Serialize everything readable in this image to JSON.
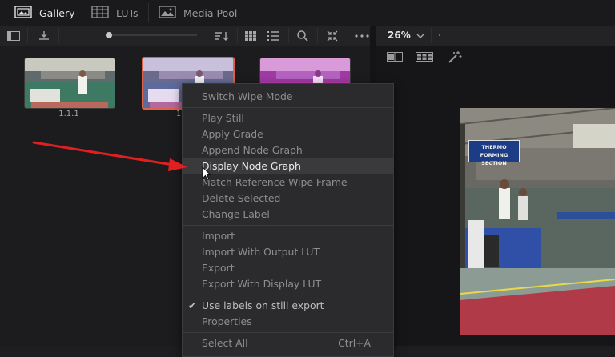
{
  "top_tabs": [
    {
      "label": "Gallery",
      "icon": "gallery-icon"
    },
    {
      "label": "LUTs",
      "icon": "luts-icon"
    },
    {
      "label": "Media Pool",
      "icon": "media-pool-icon"
    }
  ],
  "viewer": {
    "zoom": "26%"
  },
  "thumbnails": [
    {
      "label": "1.1.1"
    },
    {
      "label": "1"
    },
    {
      "label": ""
    }
  ],
  "context_menu": {
    "items": [
      {
        "label": "Switch Wipe Mode",
        "enabled": false
      },
      {
        "label": "Play Still",
        "enabled": false
      },
      {
        "label": "Apply Grade",
        "enabled": false
      },
      {
        "label": "Append Node Graph",
        "enabled": false
      },
      {
        "label": "Display Node Graph",
        "enabled": true,
        "hover": true
      },
      {
        "label": "Match Reference Wipe Frame",
        "enabled": false
      },
      {
        "label": "Delete Selected",
        "enabled": false
      },
      {
        "label": "Change Label",
        "enabled": false
      },
      {
        "label": "Import",
        "enabled": false
      },
      {
        "label": "Import With Output LUT",
        "enabled": false
      },
      {
        "label": "Export",
        "enabled": false
      },
      {
        "label": "Export With Display LUT",
        "enabled": false
      },
      {
        "label": "Use labels on still export",
        "enabled": true,
        "checked": true
      },
      {
        "label": "Properties",
        "enabled": false
      },
      {
        "label": "Select All",
        "enabled": false,
        "shortcut": "Ctrl+A"
      }
    ]
  },
  "image_sign": {
    "line1": "THERMO FORMING",
    "line2": "SECTION"
  },
  "colors": {
    "accent_selected": "#e0624a",
    "arrow": "#e02020"
  }
}
